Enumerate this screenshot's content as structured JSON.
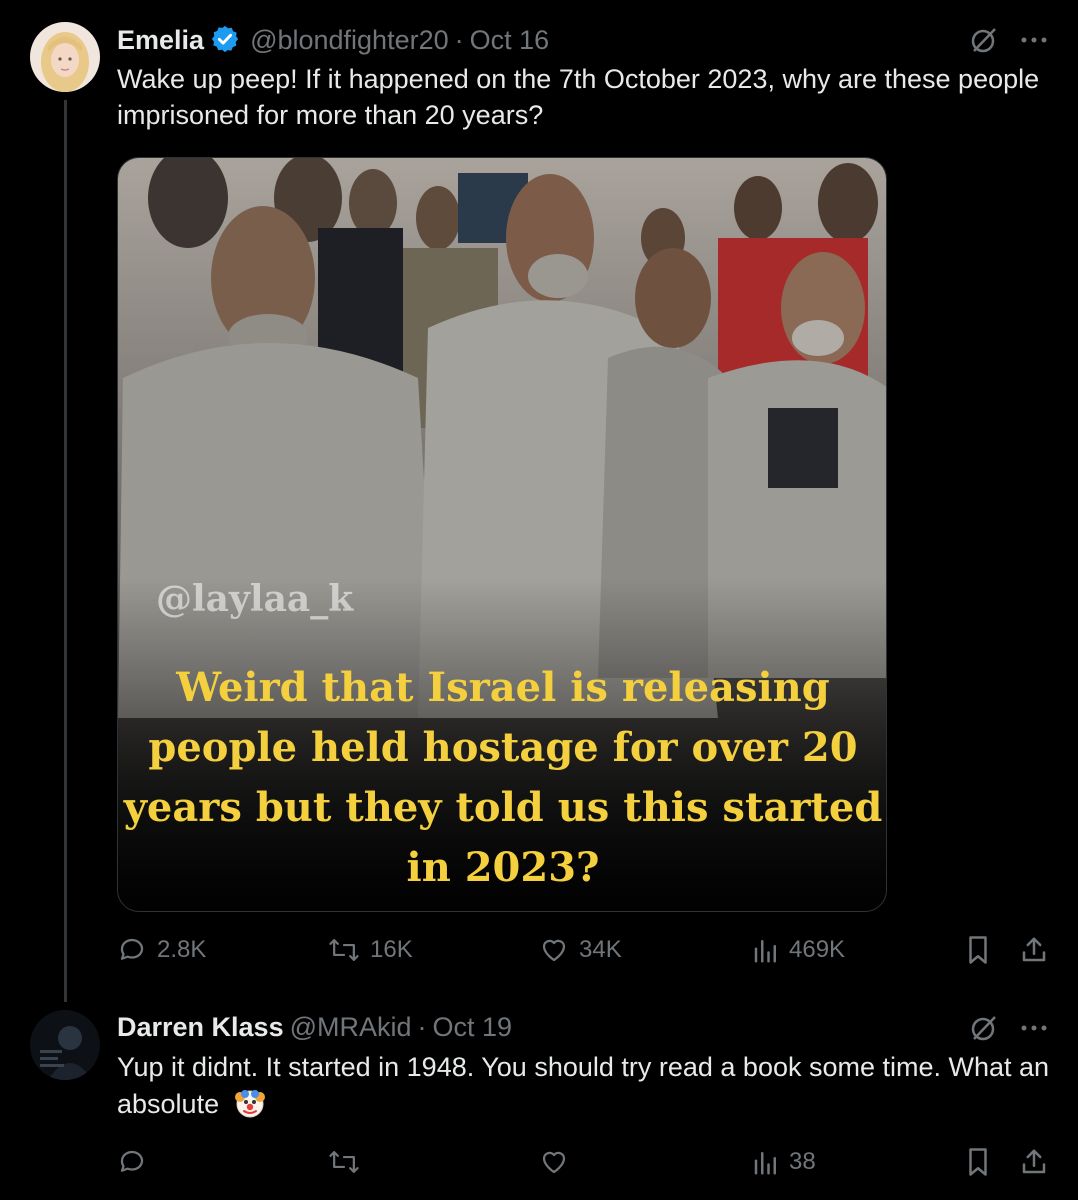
{
  "posts": [
    {
      "author": "Emelia",
      "handle": "@blondfighter20",
      "separator": "·",
      "date": "Oct 16",
      "text": "Wake up peep! If it happened on the 7th October 2023, why are these people imprisoned for more than 20 years?",
      "media": {
        "watermark": "@laylaa_k",
        "caption": "Weird that Israel is releasing people held hostage for over 20 years but they told us this started in 2023?"
      },
      "stats": {
        "replies": "2.8K",
        "reposts": "16K",
        "likes": "34K",
        "views": "469K"
      }
    },
    {
      "author": "Darren Klass",
      "handle": "@MRAkid",
      "separator": "·",
      "date": "Oct 19",
      "text": "Yup it didnt. It started in 1948. You should try read a book some time. What an absolute",
      "emoji": "clown-face",
      "stats": {
        "replies": "",
        "reposts": "",
        "likes": "",
        "views": "38"
      }
    }
  ],
  "icons": {
    "verified": "verified-badge-icon",
    "grok": "grok-icon",
    "more": "more-icon",
    "reply": "reply-icon",
    "repost": "repost-icon",
    "like": "like-icon",
    "views": "views-icon",
    "bookmark": "bookmark-icon",
    "share": "share-icon"
  },
  "colors": {
    "background": "#000000",
    "text": "#e7e9ea",
    "muted": "#71767b",
    "verified": "#1d9bf0",
    "caption": "#f4cf3e"
  }
}
